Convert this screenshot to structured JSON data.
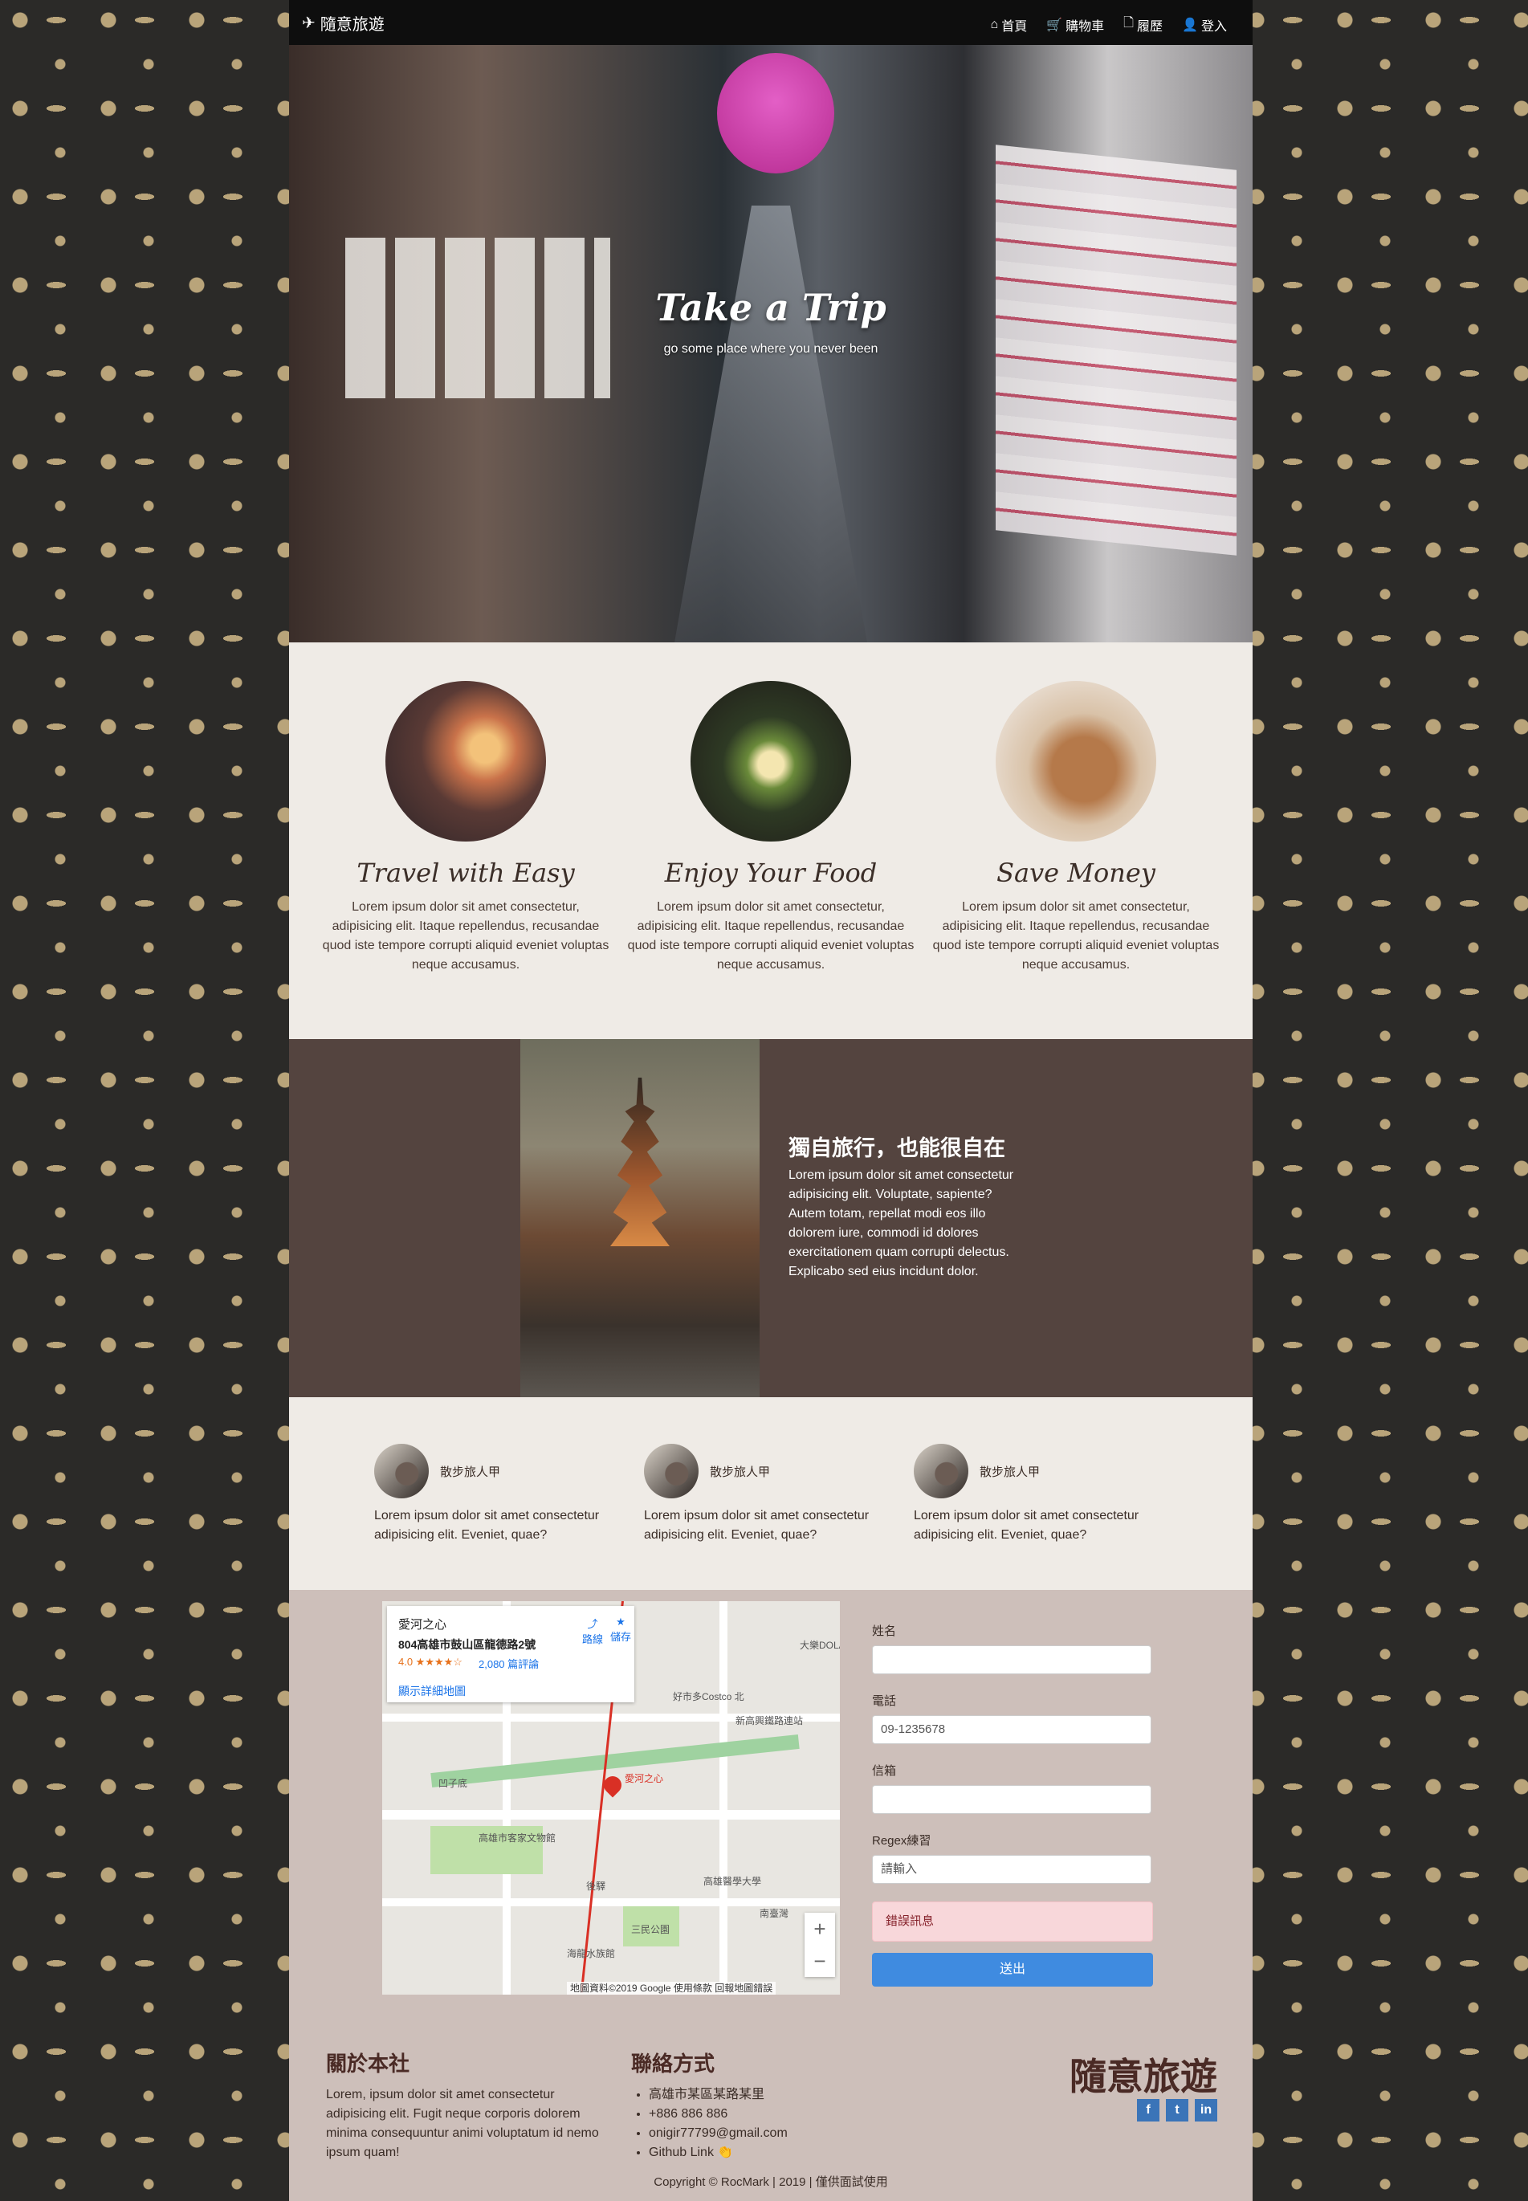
{
  "nav": {
    "brand": "隨意旅遊",
    "links": [
      {
        "label": "首頁",
        "icon": "home-icon"
      },
      {
        "label": "購物車",
        "icon": "cart-icon"
      },
      {
        "label": "履歷",
        "icon": "file-icon"
      },
      {
        "label": "登入",
        "icon": "user-icon"
      }
    ]
  },
  "hero": {
    "title": "Take a Trip",
    "subtitle": "go some place where you never been"
  },
  "features": [
    {
      "title": "Travel with Easy",
      "text": "Lorem ipsum dolor sit amet consectetur, adipisicing elit. Itaque repellendus, recusandae quod iste tempore corrupti aliquid eveniet voluptas neque accusamus."
    },
    {
      "title": "Enjoy Your Food",
      "text": "Lorem ipsum dolor sit amet consectetur, adipisicing elit. Itaque repellendus, recusandae quod iste tempore corrupti aliquid eveniet voluptas neque accusamus."
    },
    {
      "title": "Save Money",
      "text": "Lorem ipsum dolor sit amet consectetur, adipisicing elit. Itaque repellendus, recusandae quod iste tempore corrupti aliquid eveniet voluptas neque accusamus."
    }
  ],
  "solo": {
    "title": "獨自旅行，也能很自在",
    "text": "Lorem ipsum dolor sit amet consectetur adipisicing elit. Voluptate, sapiente? Autem totam, repellat modi eos illo dolorem iure, commodi id dolores exercitationem quam corrupti delectus. Explicabo sed eius incidunt dolor."
  },
  "testimonials": [
    {
      "name": "散步旅人甲",
      "text": "Lorem ipsum dolor sit amet consectetur adipisicing elit. Eveniet, quae?"
    },
    {
      "name": "散步旅人甲",
      "text": "Lorem ipsum dolor sit amet consectetur adipisicing elit. Eveniet, quae?"
    },
    {
      "name": "散步旅人甲",
      "text": "Lorem ipsum dolor sit amet consectetur adipisicing elit. Eveniet, quae?"
    }
  ],
  "map": {
    "place_name": "愛河之心",
    "address": "804高雄市鼓山區龍德路2號",
    "rating": "4.0 ★★★★☆",
    "reviews": "2,080 篇評論",
    "directions": "路線",
    "save": "儲存",
    "larger_map": "顯示詳細地圖",
    "footer": "地圖資料©2019 Google   使用條款   回報地圖錯誤",
    "labels": [
      "凹子底",
      "高雄市客家文物館",
      "後驛",
      "三民公園",
      "高雄醫學大學",
      "南臺灣",
      "海龍水族館",
      "愛河之心",
      "大樂DOLA",
      "好市多Costco 北",
      "新高興鐵路連站"
    ]
  },
  "form": {
    "name_label": "姓名",
    "name_value": "",
    "phone_label": "電話",
    "phone_placeholder": "09-1235678",
    "email_label": "信箱",
    "email_value": "",
    "regex_label": "Regex練習",
    "regex_placeholder": "請輸入",
    "error": "錯誤訊息",
    "submit": "送出"
  },
  "footer": {
    "about_title": "關於本社",
    "about_text": "Lorem, ipsum dolor sit amet consectetur adipisicing elit. Fugit neque corporis dolorem minima consequuntur animi voluptatum id nemo ipsum quam!",
    "contact_title": "聯絡方式",
    "contact_items": [
      "高雄市某區某路某里",
      "+886 886 886",
      "onigir77799@gmail.com",
      "Github Link 👏"
    ],
    "brand": "隨意旅遊",
    "copyright": "Copyright © RocMark | 2019 | 僅供面試使用"
  },
  "colors": {
    "accent": "#3f8be0",
    "dark_band": "#54443f",
    "cream": "#efebe6",
    "contact_bg": "#cdbfba"
  }
}
